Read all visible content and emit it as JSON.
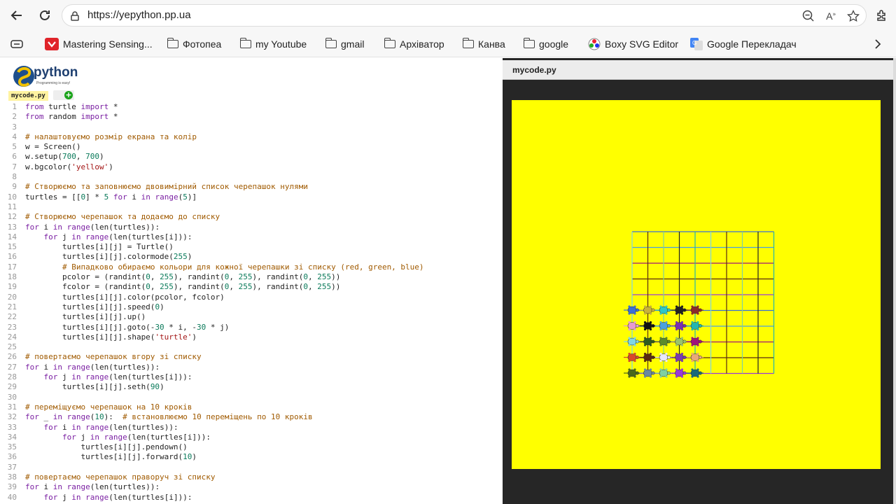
{
  "browser": {
    "url": "https://yepython.pp.ua",
    "bookmarks": [
      "Mastering Sensing...",
      "Фотопеа",
      "my Youtube",
      "gmail",
      "Архіватор",
      "Канва",
      "google",
      "Boxy SVG Editor",
      "Google Перекладач"
    ]
  },
  "editor": {
    "logo_text": "python",
    "logo_tagline": "Programming is easy!",
    "file_tab": "mycode.py",
    "lines": [
      [
        [
          "k",
          "from"
        ],
        [
          "t",
          " turtle "
        ],
        [
          "k",
          "import"
        ],
        [
          "t",
          " *"
        ]
      ],
      [
        [
          "k",
          "from"
        ],
        [
          "t",
          " random "
        ],
        [
          "k",
          "import"
        ],
        [
          "t",
          " *"
        ]
      ],
      [],
      [
        [
          "c",
          "# налаштовуємо розмір екрана та колір"
        ]
      ],
      [
        [
          "t",
          "w = Screen()"
        ]
      ],
      [
        [
          "t",
          "w.setup("
        ],
        [
          "n",
          "700"
        ],
        [
          "t",
          ", "
        ],
        [
          "n",
          "700"
        ],
        [
          "t",
          ")"
        ]
      ],
      [
        [
          "t",
          "w.bgcolor("
        ],
        [
          "s",
          "'yellow'"
        ],
        [
          "t",
          ")"
        ]
      ],
      [],
      [
        [
          "c",
          "# Створюємо та заповнюємо двовимірний список черепашок нулями"
        ]
      ],
      [
        [
          "t",
          "turtles = [["
        ],
        [
          "n",
          "0"
        ],
        [
          "t",
          "] * "
        ],
        [
          "n",
          "5"
        ],
        [
          "t",
          " "
        ],
        [
          "k",
          "for"
        ],
        [
          "t",
          " i "
        ],
        [
          "k",
          "in"
        ],
        [
          "t",
          " "
        ],
        [
          "k",
          "range"
        ],
        [
          "t",
          "("
        ],
        [
          "n",
          "5"
        ],
        [
          "t",
          ")]"
        ]
      ],
      [],
      [
        [
          "c",
          "# Створюємо черепашок та додаємо до списку"
        ]
      ],
      [
        [
          "k",
          "for"
        ],
        [
          "t",
          " i "
        ],
        [
          "k",
          "in"
        ],
        [
          "t",
          " "
        ],
        [
          "k",
          "range"
        ],
        [
          "t",
          "(len(turtles)):"
        ]
      ],
      [
        [
          "t",
          "    "
        ],
        [
          "k",
          "for"
        ],
        [
          "t",
          " j "
        ],
        [
          "k",
          "in"
        ],
        [
          "t",
          " "
        ],
        [
          "k",
          "range"
        ],
        [
          "t",
          "(len(turtles[i])):"
        ]
      ],
      [
        [
          "t",
          "        turtles[i][j] = Turtle()"
        ]
      ],
      [
        [
          "t",
          "        turtles[i][j].colormode("
        ],
        [
          "n",
          "255"
        ],
        [
          "t",
          ")"
        ]
      ],
      [
        [
          "t",
          "        "
        ],
        [
          "c",
          "# Випадково обираємо кольори для кожної черепашки зі списку (red, green, blue)"
        ]
      ],
      [
        [
          "t",
          "        pcolor = (randint("
        ],
        [
          "n",
          "0"
        ],
        [
          "t",
          ", "
        ],
        [
          "n",
          "255"
        ],
        [
          "t",
          "), randint("
        ],
        [
          "n",
          "0"
        ],
        [
          "t",
          ", "
        ],
        [
          "n",
          "255"
        ],
        [
          "t",
          "), randint("
        ],
        [
          "n",
          "0"
        ],
        [
          "t",
          ", "
        ],
        [
          "n",
          "255"
        ],
        [
          "t",
          "))"
        ]
      ],
      [
        [
          "t",
          "        fcolor = (randint("
        ],
        [
          "n",
          "0"
        ],
        [
          "t",
          ", "
        ],
        [
          "n",
          "255"
        ],
        [
          "t",
          "), randint("
        ],
        [
          "n",
          "0"
        ],
        [
          "t",
          ", "
        ],
        [
          "n",
          "255"
        ],
        [
          "t",
          "), randint("
        ],
        [
          "n",
          "0"
        ],
        [
          "t",
          ", "
        ],
        [
          "n",
          "255"
        ],
        [
          "t",
          "))"
        ]
      ],
      [
        [
          "t",
          "        turtles[i][j].color(pcolor, fcolor)"
        ]
      ],
      [
        [
          "t",
          "        turtles[i][j].speed("
        ],
        [
          "n",
          "0"
        ],
        [
          "t",
          ")"
        ]
      ],
      [
        [
          "t",
          "        turtles[i][j].up()"
        ]
      ],
      [
        [
          "t",
          "        turtles[i][j].goto(-"
        ],
        [
          "n",
          "30"
        ],
        [
          "t",
          " * i, -"
        ],
        [
          "n",
          "30"
        ],
        [
          "t",
          " * j)"
        ]
      ],
      [
        [
          "t",
          "        turtles[i][j].shape("
        ],
        [
          "s",
          "'turtle'"
        ],
        [
          "t",
          ")"
        ]
      ],
      [],
      [
        [
          "c",
          "# повертаємо черепашок вгору зі списку"
        ]
      ],
      [
        [
          "k",
          "for"
        ],
        [
          "t",
          " i "
        ],
        [
          "k",
          "in"
        ],
        [
          "t",
          " "
        ],
        [
          "k",
          "range"
        ],
        [
          "t",
          "(len(turtles)):"
        ]
      ],
      [
        [
          "t",
          "    "
        ],
        [
          "k",
          "for"
        ],
        [
          "t",
          " j "
        ],
        [
          "k",
          "in"
        ],
        [
          "t",
          " "
        ],
        [
          "k",
          "range"
        ],
        [
          "t",
          "(len(turtles[i])):"
        ]
      ],
      [
        [
          "t",
          "        turtles[i][j].seth("
        ],
        [
          "n",
          "90"
        ],
        [
          "t",
          ")"
        ]
      ],
      [],
      [
        [
          "c",
          "# переміщуємо черепашок на 10 кроків"
        ]
      ],
      [
        [
          "k",
          "for"
        ],
        [
          "t",
          " _ "
        ],
        [
          "k",
          "in"
        ],
        [
          "t",
          " "
        ],
        [
          "k",
          "range"
        ],
        [
          "t",
          "("
        ],
        [
          "n",
          "10"
        ],
        [
          "t",
          "):  "
        ],
        [
          "c",
          "# встановлюємо 10 переміщень по 10 кроків"
        ]
      ],
      [
        [
          "t",
          "    "
        ],
        [
          "k",
          "for"
        ],
        [
          "t",
          " i "
        ],
        [
          "k",
          "in"
        ],
        [
          "t",
          " "
        ],
        [
          "k",
          "range"
        ],
        [
          "t",
          "(len(turtles)):"
        ]
      ],
      [
        [
          "t",
          "        "
        ],
        [
          "k",
          "for"
        ],
        [
          "t",
          " j "
        ],
        [
          "k",
          "in"
        ],
        [
          "t",
          " "
        ],
        [
          "k",
          "range"
        ],
        [
          "t",
          "(len(turtles[i])):"
        ]
      ],
      [
        [
          "t",
          "            turtles[i][j].pendown()"
        ]
      ],
      [
        [
          "t",
          "            turtles[i][j].forward("
        ],
        [
          "n",
          "10"
        ],
        [
          "t",
          ")"
        ]
      ],
      [],
      [
        [
          "c",
          "# повертаємо черепашок праворуч зі списку"
        ]
      ],
      [
        [
          "k",
          "for"
        ],
        [
          "t",
          " i "
        ],
        [
          "k",
          "in"
        ],
        [
          "t",
          " "
        ],
        [
          "k",
          "range"
        ],
        [
          "t",
          "(len(turtles)):"
        ]
      ],
      [
        [
          "t",
          "    "
        ],
        [
          "k",
          "for"
        ],
        [
          "t",
          " j "
        ],
        [
          "k",
          "in"
        ],
        [
          "t",
          " "
        ],
        [
          "k",
          "range"
        ],
        [
          "t",
          "(len(turtles[i])):"
        ]
      ]
    ]
  },
  "output": {
    "title": "mycode.py",
    "canvas_bg": "#ffff00",
    "turtle_colors": [
      [
        "#3a6fd8",
        "#c9b23a",
        "#2ec7c7",
        "#222222",
        "#8b2b2b"
      ],
      [
        "#e79ad0",
        "#111111",
        "#4aa0e0",
        "#7a2fb5",
        "#22b6b0"
      ],
      [
        "#7fd6e6",
        "#2f5b1e",
        "#5b8b2a",
        "#9bc46a",
        "#a0147a"
      ],
      [
        "#d84a2a",
        "#5a2a10",
        "#e8e8ff",
        "#7a3ab0",
        "#e8a878"
      ],
      [
        "#4a6a1a",
        "#6a8aa0",
        "#7fd0a0",
        "#9a3ad8",
        "#1a6a7a"
      ]
    ]
  }
}
